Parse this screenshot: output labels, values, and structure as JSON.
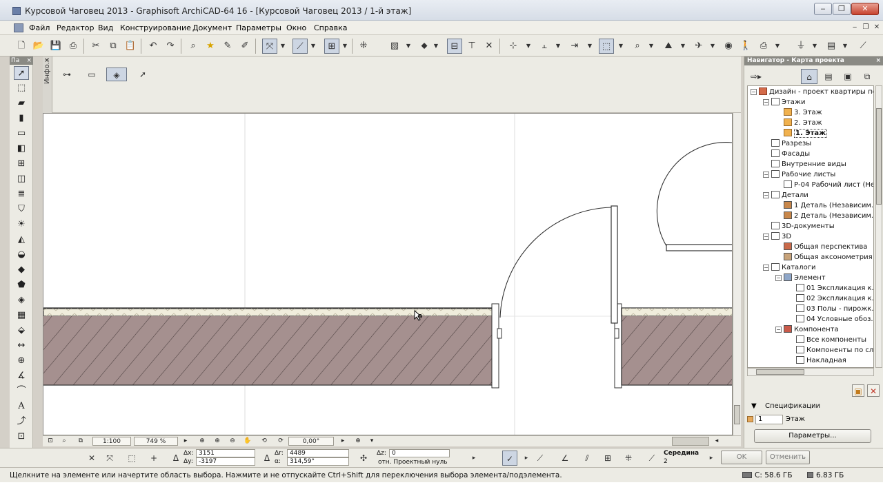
{
  "window": {
    "title": "Курсовой Чаговец 2013 - Graphisoft ArchiCAD-64 16 - [Курсовой Чаговец 2013 / 1-й этаж]",
    "minimize": "‒",
    "maximize": "❐",
    "close": "✕"
  },
  "menu": {
    "items": [
      "Файл",
      "Редактор",
      "Вид",
      "Конструирование",
      "Документ",
      "Параметры",
      "Окно",
      "Справка"
    ],
    "mdi_minimize": "‒",
    "mdi_restore": "❐",
    "mdi_close": "✕"
  },
  "toolbox": {
    "header": "Па",
    "close": "×"
  },
  "infobox": {
    "tab_label": "Инфо...",
    "close": "×"
  },
  "status_nav": {
    "scale": "1:100",
    "zoom": "749 %",
    "angle": "0,00°"
  },
  "navigator": {
    "header": "Навигатор - Карта проекта",
    "close": "×",
    "tree": {
      "root": "Дизайн - проект квартиры по...",
      "storeys": "Этажи",
      "storey_3": "3. Этаж",
      "storey_2": "2. Этаж",
      "storey_1": "1. Этаж",
      "sections": "Разрезы",
      "elevations": "Фасады",
      "interior": "Внутренние виды",
      "worksheets": "Рабочие листы",
      "worksheet_1": "Р-04 Рабочий лист (Не...",
      "details": "Детали",
      "detail_1": "1 Деталь (Независим...",
      "detail_2": "2 Деталь (Независим...",
      "documents_3d": "3D-документы",
      "three_d": "3D",
      "perspective": "Общая перспектива",
      "axonometry": "Общая аксонометрия",
      "schedules": "Каталоги",
      "element": "Элемент",
      "sched_01": "01 Экспликация к...",
      "sched_02": "02 Экспликация к...",
      "sched_03": "03 Полы - пирожк...",
      "sched_04": "04 Условные обоз...",
      "component": "Компонента",
      "comp_all": "Все компоненты",
      "comp_by": "Компоненты по сл...",
      "comp_invoice": "Накладная"
    },
    "specs_title": "Спецификации",
    "spec_field": "1",
    "spec_value": "Этаж",
    "params_button": "Параметры..."
  },
  "coords": {
    "dx_label": "Δx:",
    "dx": "3151",
    "dy_label": "Δy:",
    "dy": "-3197",
    "dr_label": "Δr:",
    "dr": "4489",
    "angle_label": "α:",
    "angle": "314,59°",
    "dz_label": "Δz:",
    "dz": "0",
    "relative_to": "отн. Проектный нуль",
    "snap_label": "Середина",
    "snap_value": "2",
    "ok": "OK",
    "cancel": "Отменить"
  },
  "status": {
    "message": "Щелкните на элементе или начертите область выбора. Нажмите и не отпускайте Ctrl+Shift для переключения выбора элемента/подэлемента.",
    "disk_c": "С: 58.6 ГБ",
    "memory": "6.83 ГБ"
  },
  "colors": {
    "wall_fill": "#a5908f",
    "wall_finish": "#f0eddc",
    "hatch": "#4a3e3e",
    "canvas_bg": "#ffffff"
  }
}
